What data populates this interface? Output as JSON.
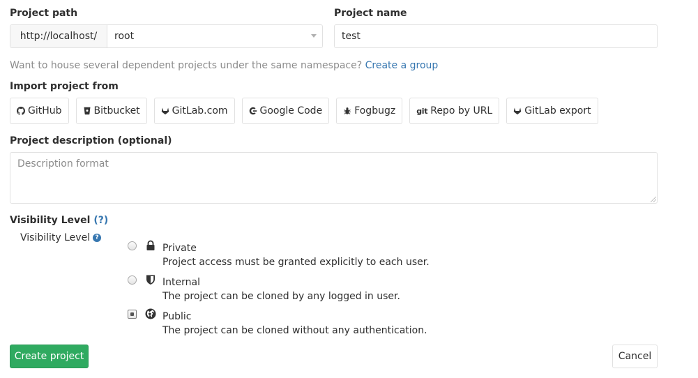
{
  "project_path": {
    "label": "Project path",
    "prefix": "http://localhost/",
    "namespace": "root"
  },
  "project_name": {
    "label": "Project name",
    "value": "test"
  },
  "namespace_hint": {
    "text": "Want to house several dependent projects under the same namespace?",
    "link": "Create a group"
  },
  "import": {
    "label": "Import project from",
    "sources": [
      {
        "label": "GitHub",
        "icon": "github-icon"
      },
      {
        "label": "Bitbucket",
        "icon": "bitbucket-icon"
      },
      {
        "label": "GitLab.com",
        "icon": "gitlab-icon"
      },
      {
        "label": "Google Code",
        "icon": "google-icon"
      },
      {
        "label": "Fogbugz",
        "icon": "bug-icon"
      },
      {
        "label": "Repo by URL",
        "icon": "git-icon",
        "icon_text": "git"
      },
      {
        "label": "GitLab export",
        "icon": "gitlab-icon"
      }
    ]
  },
  "description": {
    "label": "Project description (optional)",
    "placeholder": "Description format"
  },
  "visibility": {
    "label": "Visibility Level",
    "help_link": "(?)",
    "sub_label": "Visibility Level",
    "help_icon": "?",
    "selected": "Public",
    "options": [
      {
        "title": "Private",
        "description": "Project access must be granted explicitly to each user.",
        "icon": "lock-icon"
      },
      {
        "title": "Internal",
        "description": "The project can be cloned by any logged in user.",
        "icon": "shield-icon"
      },
      {
        "title": "Public",
        "description": "The project can be cloned without any authentication.",
        "icon": "globe-icon"
      }
    ]
  },
  "actions": {
    "create": "Create project",
    "cancel": "Cancel"
  },
  "colors": {
    "primary_green": "#2faa60",
    "link_blue": "#3777b0",
    "border": "#e1e1e1"
  }
}
